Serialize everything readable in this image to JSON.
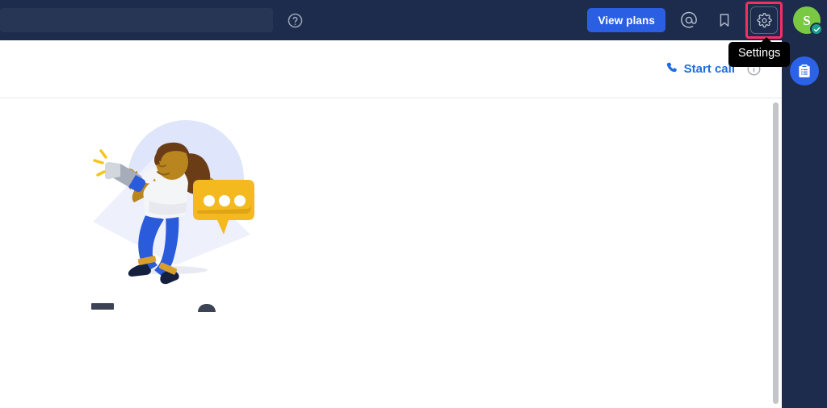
{
  "topbar": {
    "search": {
      "value": "",
      "placeholder": ""
    },
    "help_icon": "help-circle-icon",
    "view_plans_label": "View plans",
    "mention_icon": "at-mention-icon",
    "bookmark_icon": "bookmark-icon",
    "settings_icon": "gear-icon",
    "avatar_initial": "S",
    "avatar_badge_icon": "check-badge-icon",
    "colors": {
      "bar_background": "#1d2c4c",
      "search_background": "#273655",
      "primary_button": "#2b5fe3",
      "highlight_outline": "#f72e62",
      "avatar_green": "#7ac943",
      "avatar_badge_teal": "#1a9e8f"
    }
  },
  "content_header": {
    "start_call_label": "Start call",
    "phone_icon": "phone-icon",
    "info_icon": "info-circle-icon",
    "start_call_color": "#1c6fe0"
  },
  "main": {
    "illustration_name": "person-with-megaphone-illustration",
    "illustration_colors": {
      "background_circle": "#dfe5fa",
      "shadow": "#eef1fc",
      "shirt": "#f4f5f7",
      "pants": "#2a5bdb",
      "skin": "#b8851f",
      "hair": "#5b3417",
      "speech_bubble": "#f5b920",
      "megaphone_cone": "#a6adb9",
      "megaphone_handle": "#2a5bdb",
      "sound_lines": "#f5c518"
    }
  },
  "scrollbar": {
    "name": "vertical-scrollbar",
    "thumb_color": "#c3c5c9"
  },
  "right_rail": {
    "clipboard_button_icon": "clipboard-icon",
    "button_color": "#2b62e8"
  },
  "tooltip": {
    "text": "Settings",
    "background": "#000000"
  }
}
